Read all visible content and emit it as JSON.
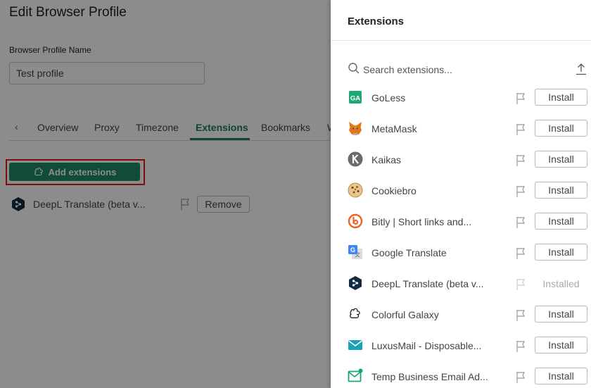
{
  "page": {
    "title": "Edit Browser Profile",
    "profile_name_label": "Browser Profile Name",
    "profile_name_value": "Test profile"
  },
  "tabs": {
    "items": [
      {
        "label": "Overview"
      },
      {
        "label": "Proxy"
      },
      {
        "label": "Timezone"
      },
      {
        "label": "Extensions",
        "active": true
      },
      {
        "label": "Bookmarks"
      },
      {
        "label": "W"
      }
    ]
  },
  "actions": {
    "add_extensions_label": "Add extensions"
  },
  "installed_extensions": [
    {
      "name": "DeepL Translate (beta v...",
      "remove_label": "Remove",
      "icon": "deepl-icon"
    }
  ],
  "drawer": {
    "title": "Extensions",
    "search_placeholder": "Search extensions...",
    "install_label": "Install",
    "installed_label": "Installed",
    "items": [
      {
        "name": "GoLess",
        "icon": "ga-icon",
        "status": "install"
      },
      {
        "name": "MetaMask",
        "icon": "metamask-fox-icon",
        "status": "install"
      },
      {
        "name": "Kaikas",
        "icon": "kaikas-icon",
        "status": "install"
      },
      {
        "name": "Cookiebro",
        "icon": "cookie-icon",
        "status": "install"
      },
      {
        "name": "Bitly | Short links and...",
        "icon": "bitly-icon",
        "status": "install"
      },
      {
        "name": "Google Translate",
        "icon": "google-translate-icon",
        "status": "install"
      },
      {
        "name": "DeepL Translate (beta v...",
        "icon": "deepl-icon",
        "status": "installed"
      },
      {
        "name": "Colorful Galaxy",
        "icon": "puzzle-icon",
        "status": "install"
      },
      {
        "name": "LuxusMail - Disposable...",
        "icon": "mail-icon",
        "status": "install"
      },
      {
        "name": "Temp Business Email Ad...",
        "icon": "mail-badge-icon",
        "status": "install"
      }
    ]
  },
  "colors": {
    "accent": "#1a7f5a",
    "button_green": "#1f8a63",
    "highlight": "#e0201b",
    "overlay": "rgba(0,0,0,0.45)"
  }
}
